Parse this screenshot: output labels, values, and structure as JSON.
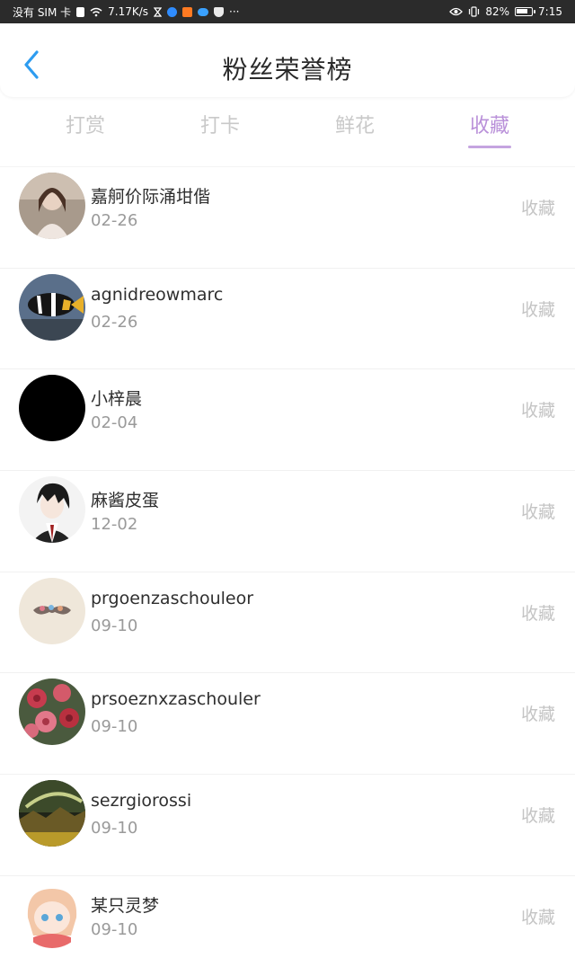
{
  "status_bar": {
    "carrier": "没有 SIM 卡",
    "speed": "7.17K/s",
    "more": "···",
    "battery": "82%",
    "battery_level": 0.82,
    "time": "7:15"
  },
  "header": {
    "title": "粉丝荣誉榜"
  },
  "tabs": [
    {
      "label": "打赏",
      "active": false
    },
    {
      "label": "打卡",
      "active": false
    },
    {
      "label": "鲜花",
      "active": false
    },
    {
      "label": "收藏",
      "active": true
    }
  ],
  "colors": {
    "accent": "#b990d9",
    "tab_inactive": "#c9c9c9",
    "back_arrow": "#2d9cf0"
  },
  "fans": [
    {
      "name": "嘉舸价际涌坩偕",
      "date": "02-26",
      "action": "收藏",
      "avatar": "girl-photo-avatar"
    },
    {
      "name": "agnidreowmarc",
      "date": "02-26",
      "action": "收藏",
      "avatar": "clownfish-avatar"
    },
    {
      "name": "小梓晨",
      "date": "02-04",
      "action": "收藏",
      "avatar": "black-circle-avatar"
    },
    {
      "name": "麻酱皮蛋",
      "date": "12-02",
      "action": "收藏",
      "avatar": "anime-boy-avatar"
    },
    {
      "name": "prgoenzaschouleor",
      "date": "09-10",
      "action": "收藏",
      "avatar": "mustache-avatar"
    },
    {
      "name": "prsoeznxzaschouler",
      "date": "09-10",
      "action": "收藏",
      "avatar": "roses-avatar"
    },
    {
      "name": "sezrgiorossi",
      "date": "09-10",
      "action": "收藏",
      "avatar": "landscape-avatar"
    },
    {
      "name": "某只灵梦",
      "date": "09-10",
      "action": "收藏",
      "avatar": "chibi-girl-avatar"
    }
  ]
}
